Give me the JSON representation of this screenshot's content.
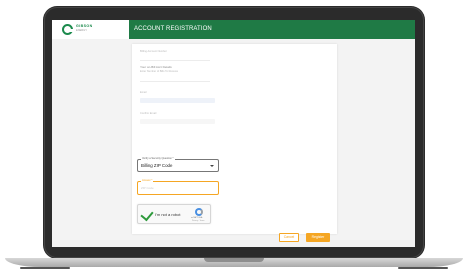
{
  "header": {
    "title": "ACCOUNT REGISTRATION",
    "logo_name": "GIBSON",
    "logo_sub": "ENERGY"
  },
  "form": {
    "billing_account_label": "Billing Account Number",
    "account_hint": "Your on-Bill Acct Details",
    "account_subhint": "Enter Number of Bills To Receive",
    "email_label": "Email",
    "confirm_email_label": "Confirm Email",
    "security_question_legend": "Verify a Security Question *",
    "security_question_value": "Billing ZIP Code",
    "zip_legend": "Answer *",
    "zip_placeholder": "ZIP Code",
    "captcha_label": "I'm not a robot",
    "captcha_brand": "reCAPTCHA",
    "captcha_terms": "Privacy - Terms",
    "cancel_label": "Cancel",
    "register_label": "Register"
  },
  "colors": {
    "header_green": "#1f7a45",
    "accent_orange": "#f5a623"
  }
}
